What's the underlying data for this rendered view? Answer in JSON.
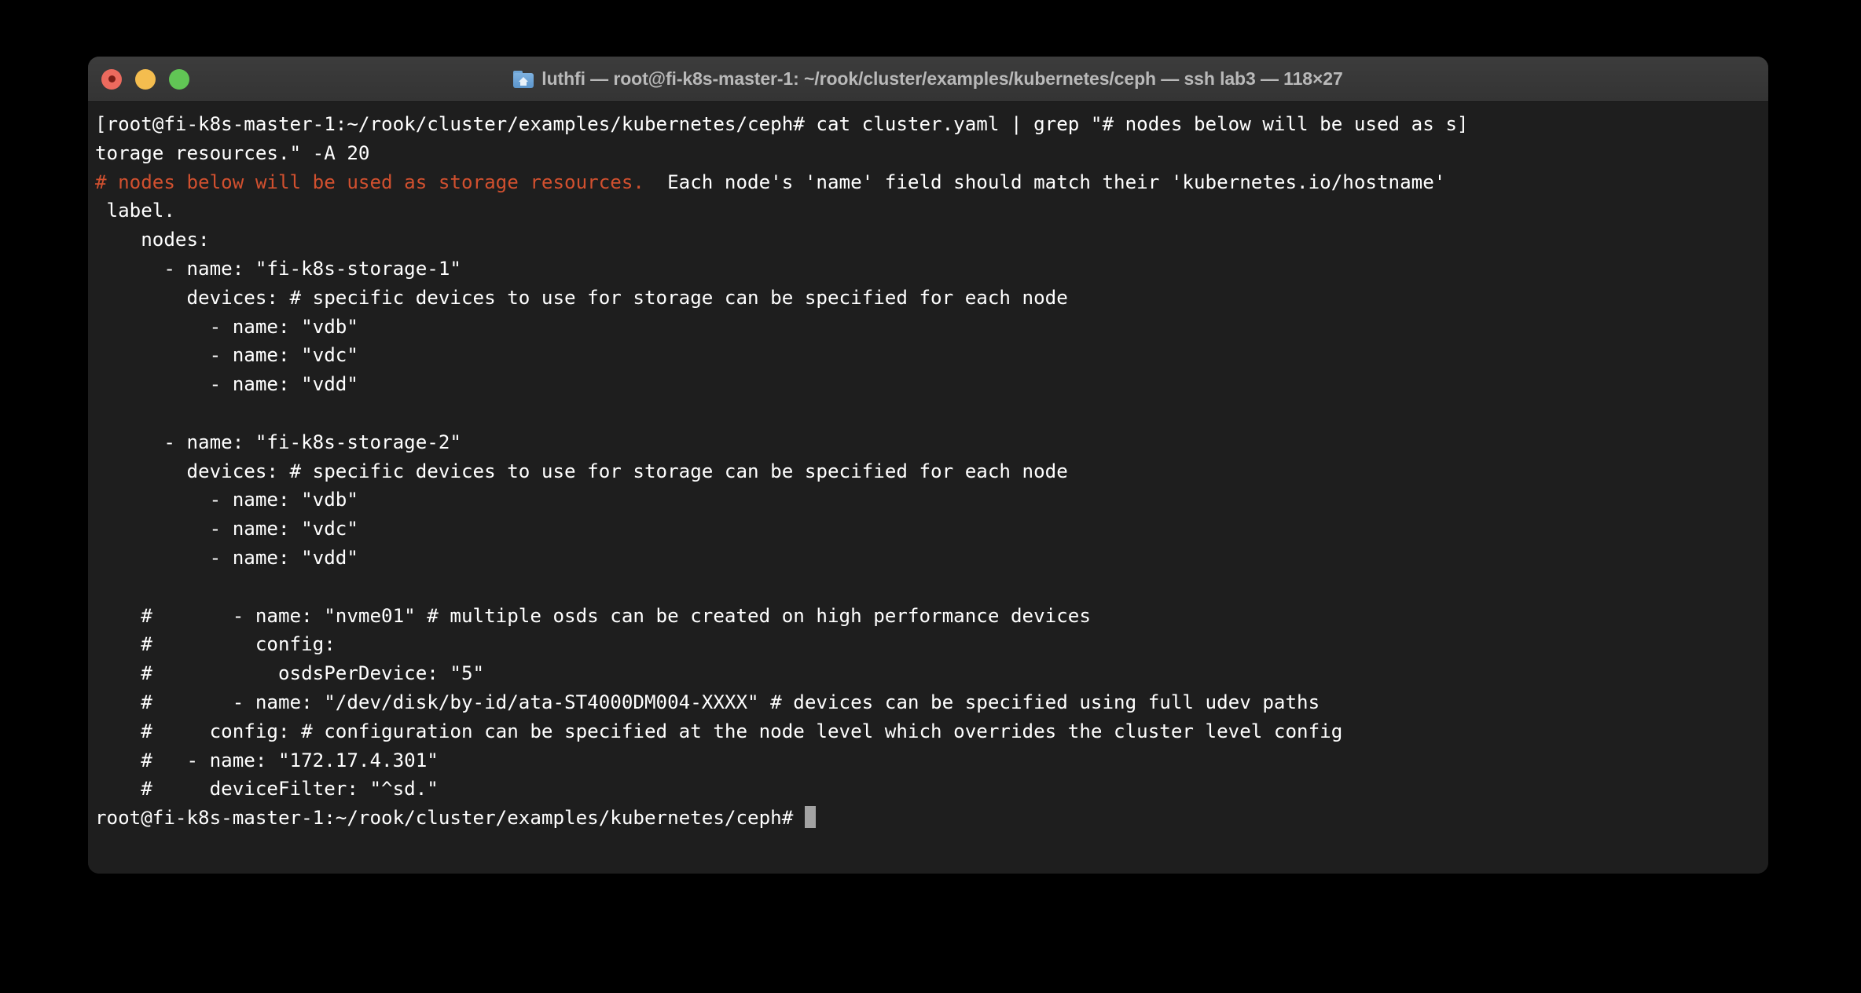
{
  "window": {
    "title": "luthfi — root@fi-k8s-master-1: ~/rook/cluster/examples/kubernetes/ceph — ssh lab3 — 118×27",
    "folder_icon": "home-folder-icon",
    "traffic_lights": {
      "close_label": "close",
      "minimize_label": "minimize",
      "zoom_label": "zoom",
      "close_color": "#ec6a5e",
      "minimize_color": "#f4bd4f",
      "zoom_color": "#61c555"
    },
    "background_color": "#1e1e1e",
    "titlebar_color": "#3a3a3a"
  },
  "terminal": {
    "foreground_color": "#ffffff",
    "match_color": "#d1502f",
    "cursor_color": "#a3a3a3",
    "columns": "118",
    "rows": "27",
    "prompt": "root@fi-k8s-master-1:~/rook/cluster/examples/kubernetes/ceph#",
    "command": "cat cluster.yaml | grep \"# nodes below will be used as storage resources.\" -A 20",
    "lines": [
      {
        "text": "[root@fi-k8s-master-1:~/rook/cluster/examples/kubernetes/ceph# cat cluster.yaml | grep \"# nodes below will be used as s]"
      },
      {
        "text": "torage resources.\" -A 20"
      },
      {
        "match": "# nodes below will be used as storage resources.",
        "text": "  Each node's 'name' field should match their 'kubernetes.io/hostname'"
      },
      {
        "text": " label."
      },
      {
        "text": "    nodes:"
      },
      {
        "text": "      - name: \"fi-k8s-storage-1\""
      },
      {
        "text": "        devices: # specific devices to use for storage can be specified for each node"
      },
      {
        "text": "          - name: \"vdb\""
      },
      {
        "text": "          - name: \"vdc\""
      },
      {
        "text": "          - name: \"vdd\""
      },
      {
        "text": ""
      },
      {
        "text": "      - name: \"fi-k8s-storage-2\""
      },
      {
        "text": "        devices: # specific devices to use for storage can be specified for each node"
      },
      {
        "text": "          - name: \"vdb\""
      },
      {
        "text": "          - name: \"vdc\""
      },
      {
        "text": "          - name: \"vdd\""
      },
      {
        "text": ""
      },
      {
        "text": "    #       - name: \"nvme01\" # multiple osds can be created on high performance devices"
      },
      {
        "text": "    #         config:"
      },
      {
        "text": "    #           osdsPerDevice: \"5\""
      },
      {
        "text": "    #       - name: \"/dev/disk/by-id/ata-ST4000DM004-XXXX\" # devices can be specified using full udev paths"
      },
      {
        "text": "    #     config: # configuration can be specified at the node level which overrides the cluster level config"
      },
      {
        "text": "    #   - name: \"172.17.4.301\""
      },
      {
        "text": "    #     deviceFilter: \"^sd.\""
      },
      {
        "text": "root@fi-k8s-master-1:~/rook/cluster/examples/kubernetes/ceph# ",
        "cursor": true
      }
    ]
  }
}
